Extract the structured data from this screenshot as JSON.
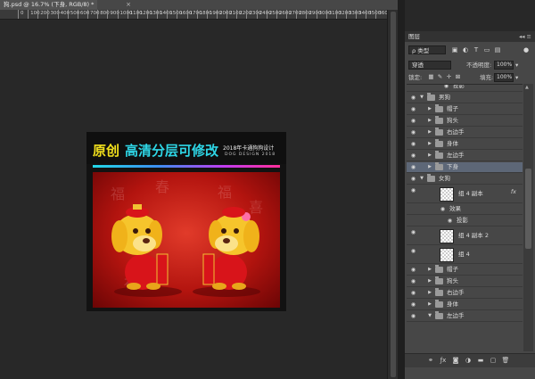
{
  "document_tab": {
    "title": "狗.psd @ 16.7% (下身, RGB/8) *",
    "close_glyph": "×"
  },
  "ruler": {
    "ticks": [
      "0",
      "100",
      "200",
      "300",
      "400",
      "500",
      "600",
      "700",
      "800",
      "900",
      "1000",
      "1100",
      "1200",
      "1300",
      "1400",
      "1500",
      "1600",
      "1700",
      "1800",
      "1900",
      "2000",
      "2100",
      "2200",
      "2300",
      "2400",
      "2500",
      "2600",
      "2700",
      "2800",
      "2900",
      "3000",
      "3100",
      "3200",
      "3300",
      "3400",
      "3500",
      "3600"
    ]
  },
  "artwork": {
    "headline_part1": "原创",
    "headline_part2": "高清分层可修改",
    "subtitle": "2018年卡通狗狗设计",
    "subtitle_en": "DOG DESIGN 2018",
    "colors": {
      "yellow": "#f2e01c",
      "cyan": "#2ed6e6",
      "poster_red": "#c4160f",
      "dog_body": "#f5c32a"
    }
  },
  "layers_panel": {
    "tab_label": "图层",
    "controls": "◂◂ ≡",
    "filter_label": "ρ 类型",
    "filter_icons": [
      "image-filter-icon",
      "adjust-filter-icon",
      "type-filter-icon",
      "shape-filter-icon",
      "smart-filter-icon",
      "toggle-filter-icon"
    ],
    "blend_mode": "穿透",
    "opacity_label": "不透明度:",
    "opacity_value": "100%",
    "lock_label": "锁定:",
    "fill_label": "填充:",
    "fill_value": "100%",
    "layers": [
      {
        "name": "投影",
        "kind": "effect",
        "indent": 2
      },
      {
        "name": "男狗",
        "kind": "group-open",
        "indent": 1
      },
      {
        "name": "帽子",
        "kind": "group",
        "indent": 2
      },
      {
        "name": "狗头",
        "kind": "group",
        "indent": 2
      },
      {
        "name": "右边手",
        "kind": "group",
        "indent": 2
      },
      {
        "name": "身体",
        "kind": "group",
        "indent": 2
      },
      {
        "name": "左边手",
        "kind": "group",
        "indent": 2
      },
      {
        "name": "下身",
        "kind": "group",
        "indent": 2,
        "selected": true
      },
      {
        "name": "女狗",
        "kind": "group-open",
        "indent": 1
      },
      {
        "name": "组 4 副本",
        "kind": "smart",
        "indent": 2,
        "fx": "fx"
      },
      {
        "name": "效果",
        "kind": "effect-head",
        "indent": 3
      },
      {
        "name": "投影",
        "kind": "effect",
        "indent": 3
      },
      {
        "name": "组 4 副本 2",
        "kind": "smart",
        "indent": 2
      },
      {
        "name": "组 4",
        "kind": "smart",
        "indent": 2
      },
      {
        "name": "帽子",
        "kind": "group",
        "indent": 2
      },
      {
        "name": "狗头",
        "kind": "group",
        "indent": 2
      },
      {
        "name": "右边手",
        "kind": "group",
        "indent": 2
      },
      {
        "name": "身体",
        "kind": "group",
        "indent": 2
      },
      {
        "name": "左边手",
        "kind": "group-open",
        "indent": 2
      }
    ],
    "bottom_icons": [
      "link-icon",
      "fx-icon",
      "mask-icon",
      "adjustment-icon",
      "folder-icon",
      "new-layer-icon",
      "trash-icon"
    ]
  }
}
